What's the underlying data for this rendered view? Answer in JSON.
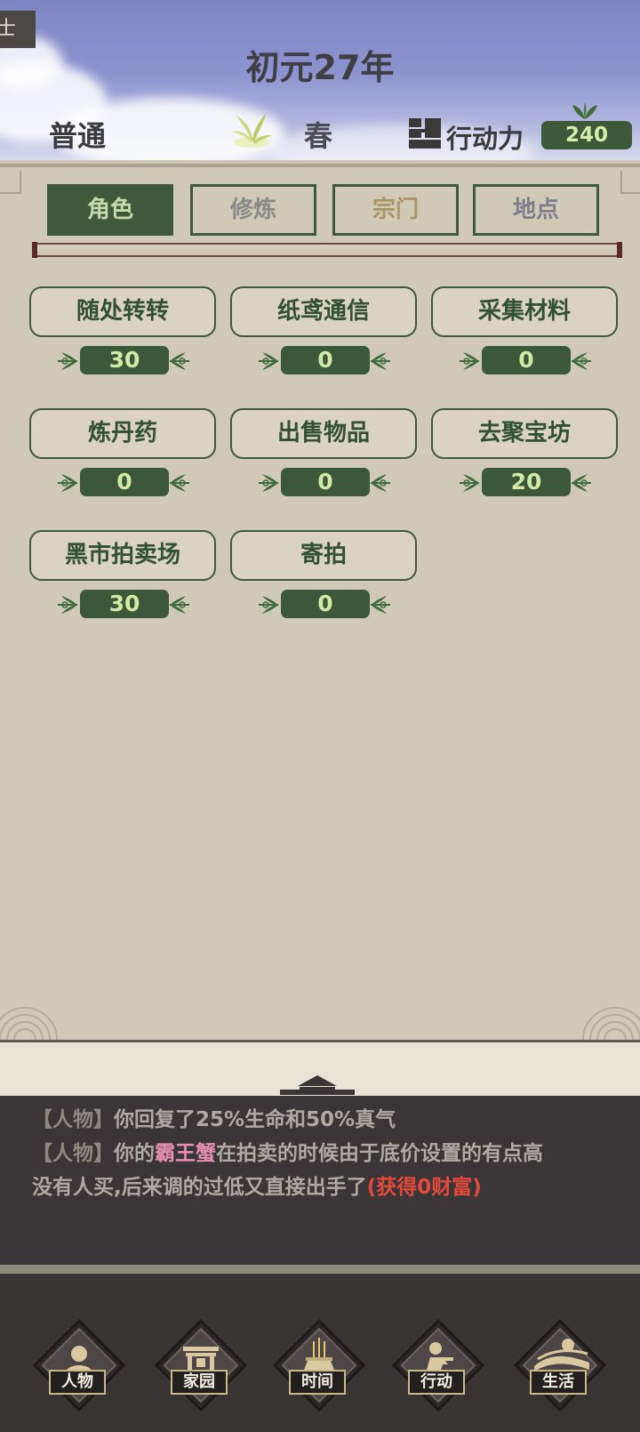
{
  "header": {
    "corner_tag": "士",
    "year_title": "初元27年",
    "mode": "普通",
    "season": "春",
    "action_points_label": "行动力",
    "action_points_value": "240"
  },
  "tabs": [
    {
      "label": "角色",
      "active": true
    },
    {
      "label": "修炼",
      "active": false
    },
    {
      "label": "宗门",
      "active": false
    },
    {
      "label": "地点",
      "active": false
    }
  ],
  "actions": [
    {
      "label": "随处转转",
      "cost": "30"
    },
    {
      "label": "纸鸢通信",
      "cost": "0"
    },
    {
      "label": "采集材料",
      "cost": "0"
    },
    {
      "label": "炼丹药",
      "cost": "0"
    },
    {
      "label": "出售物品",
      "cost": "0"
    },
    {
      "label": "去聚宝坊",
      "cost": "20"
    },
    {
      "label": "黑市拍卖场",
      "cost": "30"
    },
    {
      "label": "寄拍",
      "cost": "0"
    }
  ],
  "log": {
    "line1_tag": "【人物】",
    "line1_text": "你回复了25%生命和50%真气",
    "line2_tag": "【人物】",
    "line2_pre": "你的",
    "line2_item": "霸王蟹",
    "line2_post": "在拍卖的时候由于底价设置的有点高",
    "line3_text": "没有人买,后来调的过低又直接出手了",
    "line3_gain": "(获得0财富)"
  },
  "nav": [
    {
      "label": "人物",
      "icon": "person-icon"
    },
    {
      "label": "家园",
      "icon": "gate-icon"
    },
    {
      "label": "时间",
      "icon": "incense-icon"
    },
    {
      "label": "行动",
      "icon": "kneeling-figure-icon"
    },
    {
      "label": "生活",
      "icon": "landscape-icon"
    }
  ],
  "colors": {
    "accent_green": "#3f5a3b",
    "pill_text": "#d4e8a8",
    "item_highlight": "#e58fb1",
    "gain_highlight": "#e44a3c"
  }
}
